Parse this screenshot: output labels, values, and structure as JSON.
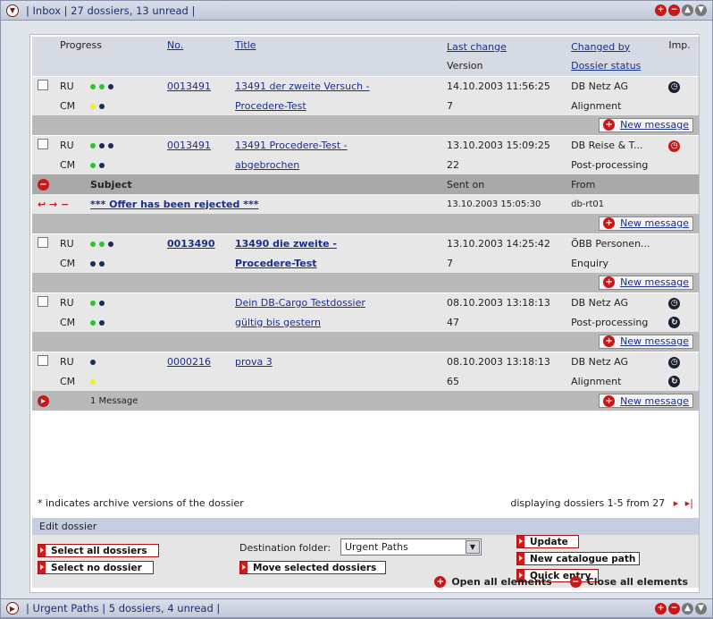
{
  "inbox_title": "| Inbox | 27 dossiers, 13 unread |",
  "urgent_title": "| Urgent Paths | 5 dossiers, 4 unread |",
  "headers": {
    "progress": "Progress",
    "no": "No.",
    "title": "Title",
    "last_change": "Last change",
    "version": "Version",
    "changed_by": "Changed by",
    "dossier_status": "Dossier status",
    "imp": "Imp."
  },
  "new_message": "New message",
  "dossiers": [
    {
      "ru": "RU",
      "cm": "CM",
      "no": "0013491",
      "title1": "13491 der zweite Versuch -",
      "title2": "Procedere-Test",
      "date": "14.10.2003 11:56:25",
      "version": "7",
      "by": "DB Netz AG",
      "status": "Alignment"
    },
    {
      "ru": "RU",
      "cm": "CM",
      "no": "0013491",
      "title1": "13491 Procedere-Test -",
      "title2": "abgebrochen",
      "date": "13.10.2003 15:09:25",
      "version": "22",
      "by": "DB Reise & T...",
      "status": "Post-processing"
    },
    {
      "ru": "RU",
      "cm": "CM",
      "no": "0013490",
      "title1": "13490 die zweite -",
      "title2": "Procedere-Test",
      "date": "13.10.2003 14:25:42",
      "version": "7",
      "by": "ÖBB Personen...",
      "status": "Enquiry"
    },
    {
      "ru": "RU",
      "cm": "CM",
      "no": "",
      "title1": "Dein DB-Cargo Testdossier",
      "title2": "gültig bis gestern",
      "date": "08.10.2003 13:18:13",
      "version": "47",
      "by": "DB Netz AG",
      "status": "Post-processing"
    },
    {
      "ru": "RU",
      "cm": "CM",
      "no": "0000216",
      "title1": "prova 3",
      "title2": "",
      "date": "08.10.2003 13:18:13",
      "version": "65",
      "by": "DB Netz AG",
      "status": "Alignment"
    }
  ],
  "messages": {
    "subject_h": "Subject",
    "sent_h": "Sent on",
    "from_h": "From",
    "subject": "*** Offer has been rejected ***",
    "sent": "13.10.2003 15:05:30",
    "from": "db-rt01"
  },
  "one_message": "1 Message",
  "footnote": "* indicates archive versions of the dossier",
  "paging": "displaying dossiers 1-5 from 27",
  "edit": {
    "title": "Edit dossier",
    "select_all": "Select all dossiers",
    "select_none": "Select no dossier",
    "dest_label": "Destination folder:",
    "dest_value": "Urgent Paths",
    "move": "Move selected dossiers",
    "update": "Update",
    "new_path": "New catalogue path",
    "quick": "Quick entry"
  },
  "open_all": "Open all elements",
  "close_all": "Close all elements"
}
